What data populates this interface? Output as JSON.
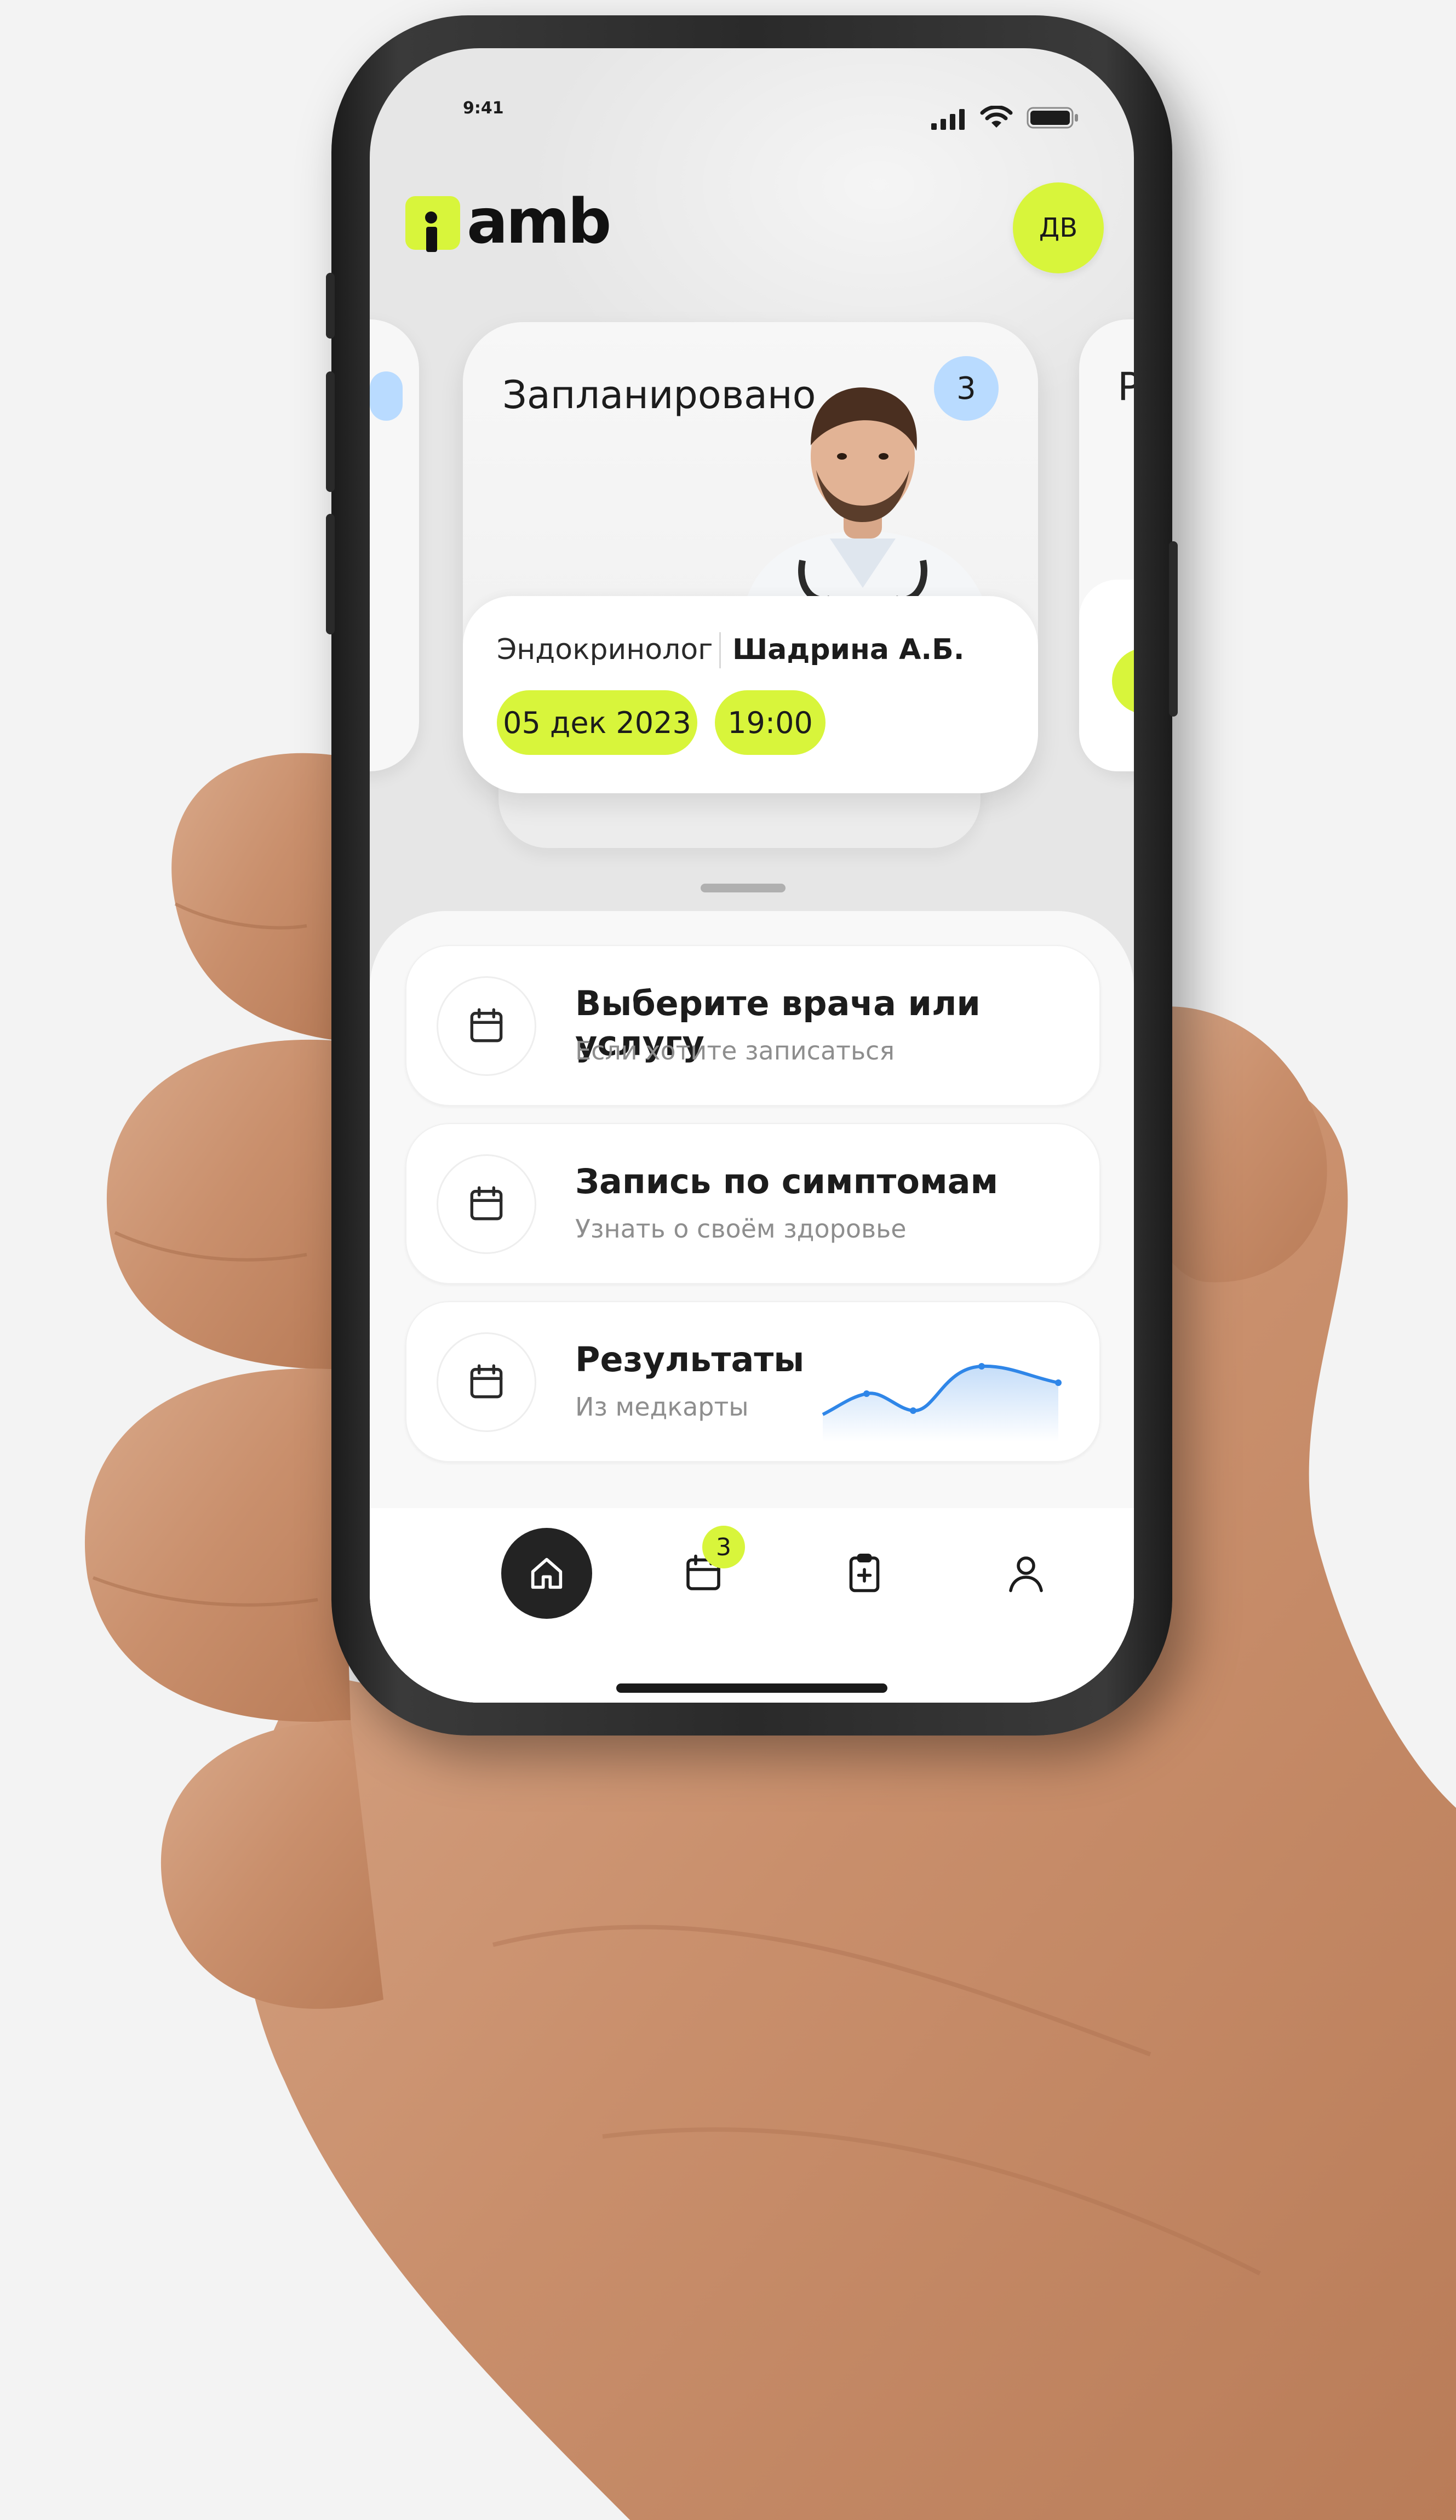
{
  "status_bar": {
    "time": "9:41"
  },
  "header": {
    "logo_text": "amb",
    "avatar_initials": "ДВ"
  },
  "appointment_card": {
    "title": "Запланировано",
    "count": "3",
    "specialty": "Эндокринолог",
    "doctor": "Шадрина А.Б.",
    "date": "05 дек 2023",
    "time": "19:00"
  },
  "next_card": {
    "title_initial": "Р"
  },
  "actions": [
    {
      "title": "Выберите врача или услугу",
      "subtitle": "Если хотите записаться",
      "icon": "calendar-icon"
    },
    {
      "title": "Запись по симптомам",
      "subtitle": "Узнать о своём здоровье",
      "icon": "calendar-icon"
    },
    {
      "title": "Результаты",
      "subtitle": "Из медкарты",
      "icon": "calendar-icon"
    }
  ],
  "tabbar": {
    "items": [
      {
        "icon": "home-icon",
        "active": true
      },
      {
        "icon": "calendar-icon",
        "badge": "3"
      },
      {
        "icon": "clipboard-plus-icon"
      },
      {
        "icon": "user-icon"
      }
    ]
  },
  "colors": {
    "accent": "#d8f53b",
    "badge_blue": "#b9dbff",
    "dark": "#232323",
    "chart_line": "#2f86e8"
  }
}
